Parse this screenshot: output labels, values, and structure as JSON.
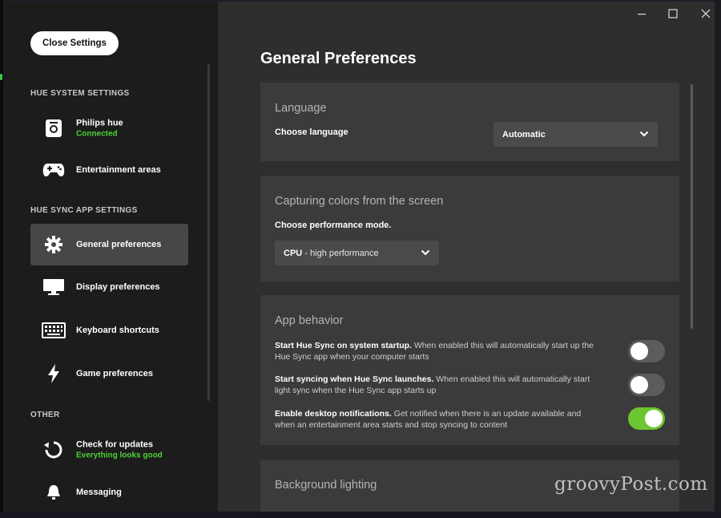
{
  "window_controls": {
    "minimize_icon": "minimize-icon",
    "maximize_icon": "maximize-icon",
    "close_icon": "close-icon"
  },
  "sidebar": {
    "close_button": "Close Settings",
    "sections": {
      "hue_system": "HUE SYSTEM SETTINGS",
      "hue_sync_app": "HUE SYNC APP SETTINGS",
      "other": "OTHER"
    },
    "items": [
      {
        "label": "Philips hue",
        "sub": "Connected",
        "icon": "bridge-icon"
      },
      {
        "label": "Entertainment areas",
        "icon": "gamepad-icon"
      },
      {
        "label": "General preferences",
        "icon": "gear-icon",
        "active": true
      },
      {
        "label": "Display preferences",
        "icon": "monitor-icon"
      },
      {
        "label": "Keyboard shortcuts",
        "icon": "keyboard-icon"
      },
      {
        "label": "Game preferences",
        "icon": "lightning-icon"
      },
      {
        "label": "Check for updates",
        "sub": "Everything looks good",
        "icon": "refresh-icon"
      },
      {
        "label": "Messaging",
        "icon": "bell-icon"
      }
    ],
    "accent_color": "#4cd137"
  },
  "main": {
    "title": "General Preferences",
    "language": {
      "title": "Language",
      "field_label": "Choose language",
      "selected": "Automatic"
    },
    "capture": {
      "title": "Capturing colors from the screen",
      "field_label": "Choose performance mode.",
      "selected_bold": "CPU",
      "selected_rest": " - high performance"
    },
    "app_behavior": {
      "title": "App behavior",
      "settings": [
        {
          "bold": "Start Hue Sync on system startup.",
          "desc": " When enabled this will automatically start up the Hue Sync app when your computer starts",
          "enabled": false
        },
        {
          "bold": "Start syncing when Hue Sync launches.",
          "desc": " When enabled this will automatically start light sync when the Hue Sync app starts up",
          "enabled": false
        },
        {
          "bold": "Enable desktop notifications.",
          "desc": " Get notified when there is an update available and when an entertainment area starts and stop syncing to content",
          "enabled": true
        }
      ],
      "toggle_on_color": "#6cc62f"
    },
    "background_lighting": {
      "title": "Background lighting"
    }
  },
  "watermark": "groovyPost.com"
}
